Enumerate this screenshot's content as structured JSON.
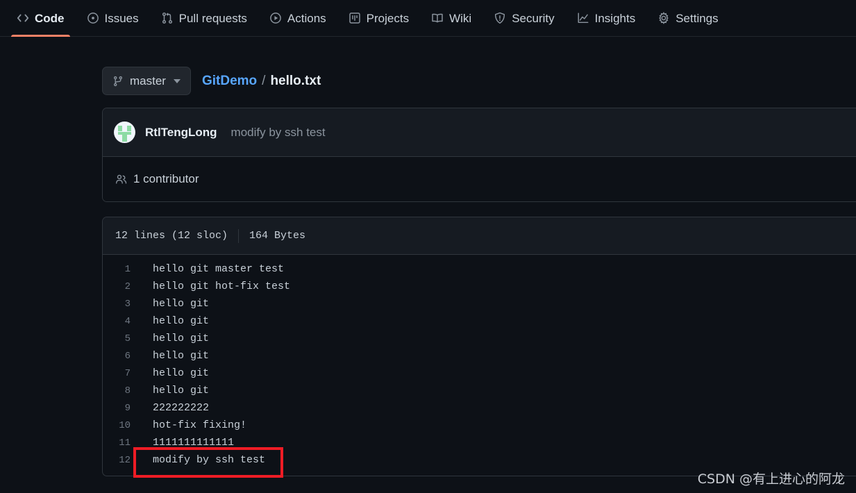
{
  "nav": {
    "tabs": [
      {
        "label": "Code",
        "icon": "code-icon",
        "active": true
      },
      {
        "label": "Issues",
        "icon": "issue-opened-icon",
        "active": false
      },
      {
        "label": "Pull requests",
        "icon": "git-pull-request-icon",
        "active": false
      },
      {
        "label": "Actions",
        "icon": "play-icon",
        "active": false
      },
      {
        "label": "Projects",
        "icon": "project-board-icon",
        "active": false
      },
      {
        "label": "Wiki",
        "icon": "book-icon",
        "active": false
      },
      {
        "label": "Security",
        "icon": "shield-icon",
        "active": false
      },
      {
        "label": "Insights",
        "icon": "graph-icon",
        "active": false
      },
      {
        "label": "Settings",
        "icon": "gear-icon",
        "active": false
      }
    ],
    "active_accent_color": "#f78166"
  },
  "file_header": {
    "branch_label": "master",
    "branch_icon": "git-branch-icon",
    "breadcrumb": {
      "repo": "GitDemo",
      "separator": "/",
      "filename": "hello.txt"
    }
  },
  "commit": {
    "author": "RtlTengLong",
    "message": "modify by ssh test",
    "avatar_icon": "identicon-avatar"
  },
  "contributors": {
    "icon": "people-icon",
    "text": "1 contributor"
  },
  "blob": {
    "lines_label": "12 lines (12 sloc)",
    "size_label": "164 Bytes",
    "code": [
      {
        "n": "1",
        "text": "hello git master test"
      },
      {
        "n": "2",
        "text": "hello git hot-fix test"
      },
      {
        "n": "3",
        "text": "hello git"
      },
      {
        "n": "4",
        "text": "hello git"
      },
      {
        "n": "5",
        "text": "hello git"
      },
      {
        "n": "6",
        "text": "hello git"
      },
      {
        "n": "7",
        "text": "hello git"
      },
      {
        "n": "8",
        "text": "hello git"
      },
      {
        "n": "9",
        "text": "222222222"
      },
      {
        "n": "10",
        "text": "hot-fix fixing!"
      },
      {
        "n": "11",
        "text": "1111111111111"
      },
      {
        "n": "12",
        "text": "modify by ssh test"
      }
    ]
  },
  "annotation": {
    "color": "#ee1c25",
    "targets_line": "12"
  },
  "watermark": {
    "text": "CSDN @有上进心的阿龙"
  },
  "theme": {
    "page_bg": "#0d1117",
    "panel_bg": "#161b22",
    "border": "#30363d",
    "text": "#c9d1d9",
    "muted": "#8b949e",
    "link": "#58a6ff"
  }
}
